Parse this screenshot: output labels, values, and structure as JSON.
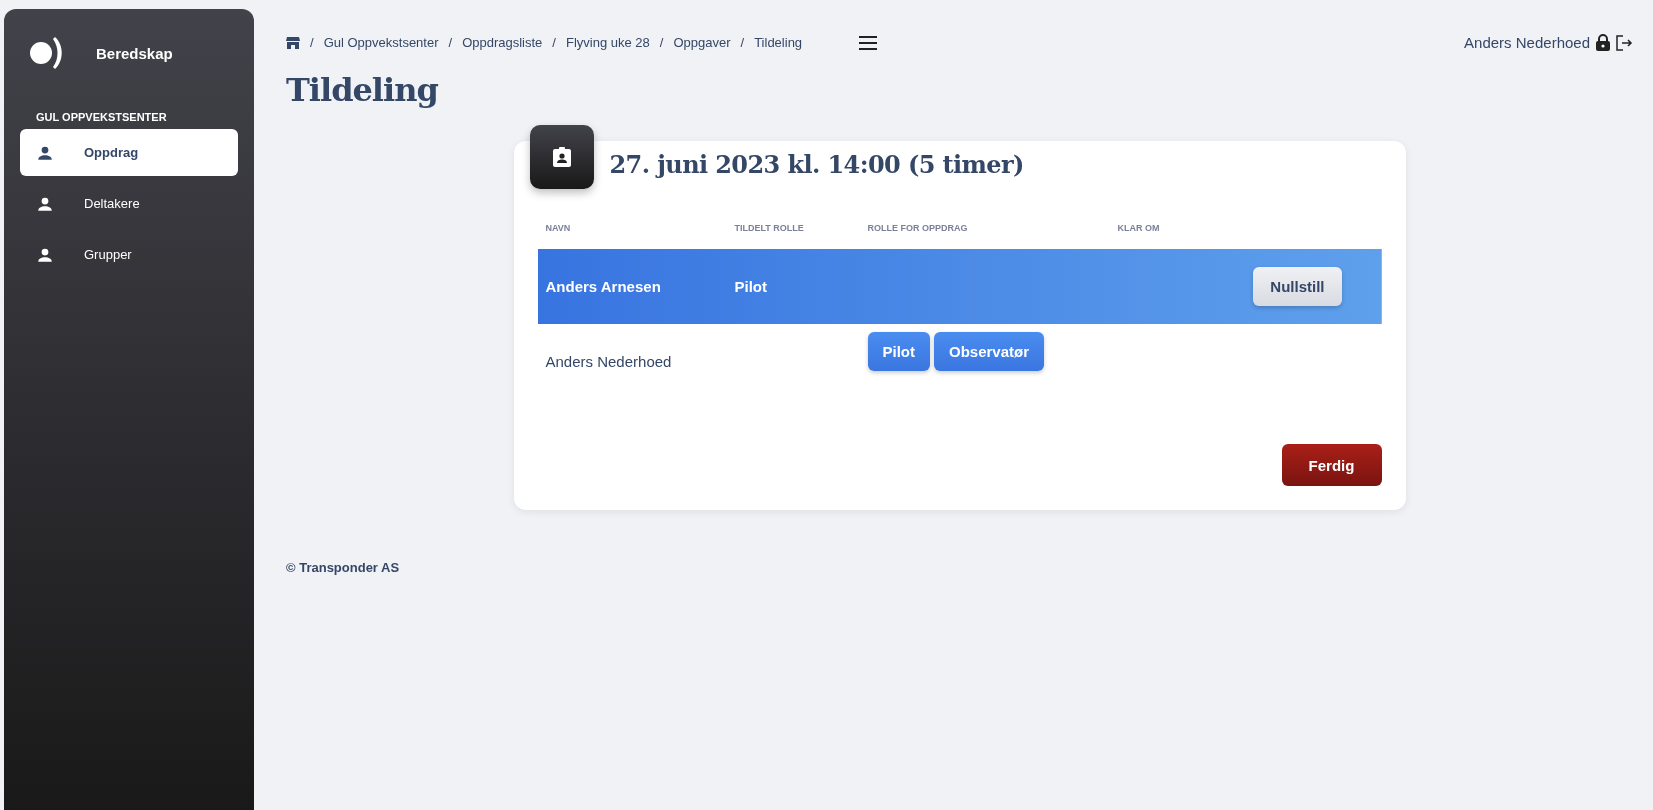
{
  "sidebar": {
    "app_name": "Beredskap",
    "section": "GUL OPPVEKSTSENTER",
    "items": [
      {
        "label": "Oppdrag",
        "selected": true
      },
      {
        "label": "Deltakere",
        "selected": false
      },
      {
        "label": "Grupper",
        "selected": false
      }
    ]
  },
  "breadcrumbs": [
    {
      "separator": "/",
      "label": "Gul Oppvekstsenter"
    },
    {
      "separator": "/",
      "label": "Oppdragsliste"
    },
    {
      "separator": "/",
      "label": "Flyving uke 28"
    },
    {
      "separator": "/",
      "label": "Oppgaver"
    },
    {
      "separator": "/",
      "label": "Tildeling"
    }
  ],
  "user": {
    "name": "Anders Nederhoed"
  },
  "page_title": "Tildeling",
  "card": {
    "title": "27. juni 2023 kl. 14:00 (5 timer)",
    "table": {
      "columns": [
        "NAVN",
        "TILDELT ROLLE",
        "ROLLE FOR OPPDRAG",
        "KLAR OM"
      ],
      "rows": [
        {
          "name": "Anders Arnesen",
          "assigned_role": "Pilot",
          "selected": true,
          "action": "Nullstill"
        },
        {
          "name": "Anders Nederhoed",
          "selected": false,
          "role_options": [
            "Pilot",
            "Observatør"
          ]
        }
      ]
    },
    "done_button": "Ferdig"
  },
  "footer": "© Transponder AS"
}
